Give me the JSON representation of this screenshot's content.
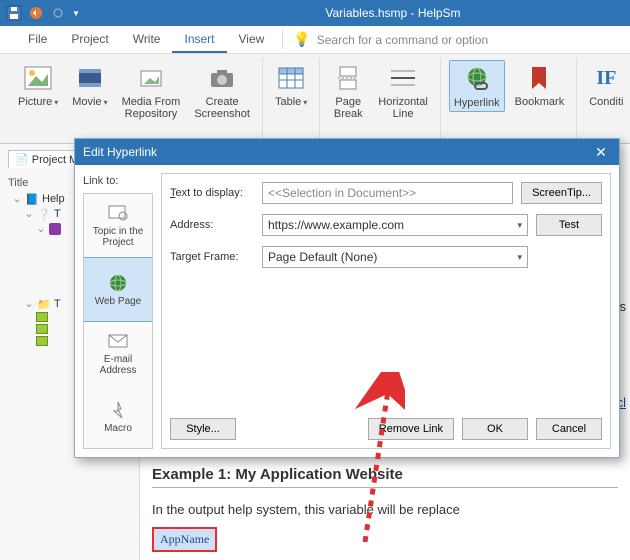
{
  "titlebar": {
    "title": "Variables.hsmp - HelpSm"
  },
  "menu": {
    "file": "File",
    "project": "Project",
    "write": "Write",
    "insert": "Insert",
    "view": "View",
    "search_placeholder": "Search for a command or option"
  },
  "ribbon": {
    "picture": "Picture",
    "movie": "Movie",
    "media": "Media From\nRepository",
    "screenshot": "Create\nScreenshot",
    "table": "Table",
    "pagebreak": "Page\nBreak",
    "hline": "Horizontal\nLine",
    "hyperlink": "Hyperlink",
    "bookmark": "Bookmark",
    "cond": "Conditi"
  },
  "sidepane": {
    "tab": "Project M",
    "col_title": "Title",
    "root": "Help",
    "tq": "T",
    "folder": "T"
  },
  "doc": {
    "heading": "Example 1: My Application Website",
    "para_pre": "In the output help system, this variable will be replace",
    "tag": "AppName",
    "truncated": [
      "is",
      "cl"
    ]
  },
  "dialog": {
    "title": "Edit Hyperlink",
    "linkto": "Link to:",
    "cats": {
      "topic": "Topic in the\nProject",
      "web": "Web Page",
      "email": "E-mail\nAddress",
      "macro": "Macro"
    },
    "text_to_display_u": "T",
    "text_to_display_rest": "ext to display:",
    "text_to_display_val": "<<Selection in Document>>",
    "screentip": "ScreenTip...",
    "address_lbl": "Address:",
    "address_val": "https://www.example.com",
    "test": "Test",
    "target_lbl": "Target Frame:",
    "target_val": "Page Default (None)",
    "style": "Style...",
    "remove": "Remove Link",
    "ok": "OK",
    "cancel": "Cancel"
  }
}
